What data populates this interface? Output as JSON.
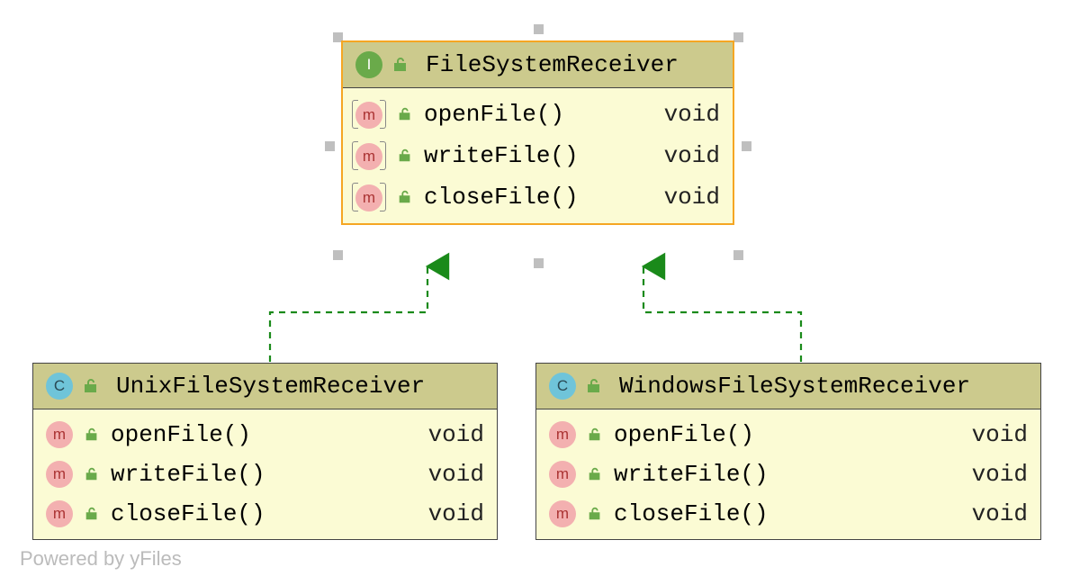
{
  "watermark": "Powered by yFiles",
  "interface": {
    "badge": "I",
    "name": "FileSystemReceiver",
    "methods": [
      {
        "name": "openFile()",
        "type": "void"
      },
      {
        "name": "writeFile()",
        "type": "void"
      },
      {
        "name": "closeFile()",
        "type": "void"
      }
    ]
  },
  "implA": {
    "badge": "C",
    "name": "UnixFileSystemReceiver",
    "methods": [
      {
        "name": "openFile()",
        "type": "void"
      },
      {
        "name": "writeFile()",
        "type": "void"
      },
      {
        "name": "closeFile()",
        "type": "void"
      }
    ]
  },
  "implB": {
    "badge": "C",
    "name": "WindowsFileSystemReceiver",
    "methods": [
      {
        "name": "openFile()",
        "type": "void"
      },
      {
        "name": "writeFile()",
        "type": "void"
      },
      {
        "name": "closeFile()",
        "type": "void"
      }
    ]
  }
}
